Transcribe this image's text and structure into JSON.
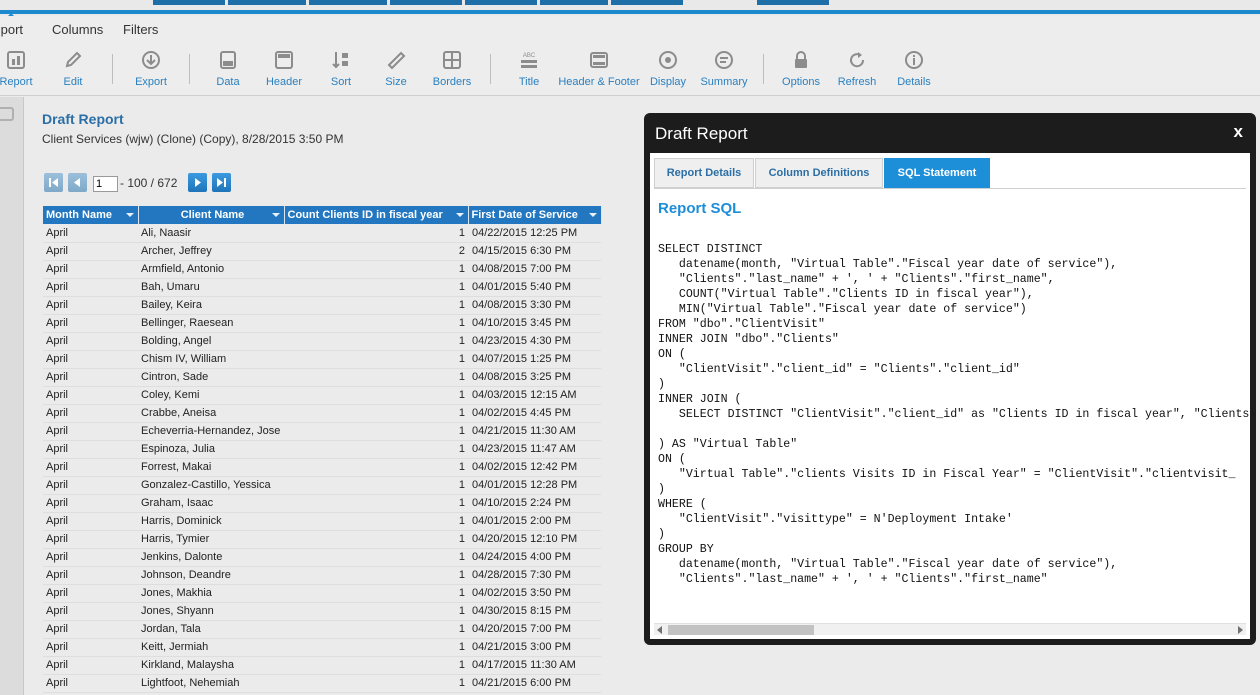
{
  "menu": {
    "items": [
      "Report",
      "Columns",
      "Filters"
    ]
  },
  "toolbar": {
    "items": [
      {
        "label": "Report",
        "icon": "report-icon"
      },
      {
        "label": "Edit",
        "icon": "pencil-icon"
      },
      {
        "label": "Export",
        "icon": "export-icon"
      },
      {
        "label": "Data",
        "icon": "data-icon"
      },
      {
        "label": "Header",
        "icon": "header-icon"
      },
      {
        "label": "Sort",
        "icon": "sort-icon"
      },
      {
        "label": "Size",
        "icon": "ruler-icon"
      },
      {
        "label": "Borders",
        "icon": "borders-icon"
      },
      {
        "label": "Title",
        "icon": "title-icon"
      },
      {
        "label": "Header & Footer",
        "icon": "header-footer-icon"
      },
      {
        "label": "Display",
        "icon": "display-icon"
      },
      {
        "label": "Summary",
        "icon": "summary-icon"
      },
      {
        "label": "Options",
        "icon": "lock-icon"
      },
      {
        "label": "Refresh",
        "icon": "refresh-icon"
      },
      {
        "label": "Details",
        "icon": "info-icon"
      }
    ]
  },
  "report": {
    "title": "Draft Report",
    "subtitle": "Client Services (wjw) (Clone) (Copy), 8/28/2015 3:50 PM"
  },
  "pager": {
    "page": "1",
    "range_text": "- 100 / 672"
  },
  "table": {
    "columns": [
      "Month Name",
      "Client Name",
      "Count Clients ID in fiscal year",
      "First Date of Service"
    ],
    "rows": [
      [
        "April",
        "Ali, Naasir",
        "1",
        "04/22/2015 12:25 PM"
      ],
      [
        "April",
        "Archer, Jeffrey",
        "2",
        "04/15/2015 6:30 PM"
      ],
      [
        "April",
        "Armfield, Antonio",
        "1",
        "04/08/2015 7:00 PM"
      ],
      [
        "April",
        "Bah, Umaru",
        "1",
        "04/01/2015 5:40 PM"
      ],
      [
        "April",
        "Bailey, Keira",
        "1",
        "04/08/2015 3:30 PM"
      ],
      [
        "April",
        "Bellinger, Raesean",
        "1",
        "04/10/2015 3:45 PM"
      ],
      [
        "April",
        "Bolding, Angel",
        "1",
        "04/23/2015 4:30 PM"
      ],
      [
        "April",
        "Chism IV, William",
        "1",
        "04/07/2015 1:25 PM"
      ],
      [
        "April",
        "Cintron, Sade",
        "1",
        "04/08/2015 3:25 PM"
      ],
      [
        "April",
        "Coley, Kemi",
        "1",
        "04/03/2015 12:15 AM"
      ],
      [
        "April",
        "Crabbe, Aneisa",
        "1",
        "04/02/2015 4:45 PM"
      ],
      [
        "April",
        "Echeverria-Hernandez, Jose",
        "1",
        "04/21/2015 11:30 AM"
      ],
      [
        "April",
        "Espinoza, Julia",
        "1",
        "04/23/2015 11:47 AM"
      ],
      [
        "April",
        "Forrest, Makai",
        "1",
        "04/02/2015 12:42 PM"
      ],
      [
        "April",
        "Gonzalez-Castillo, Yessica",
        "1",
        "04/01/2015 12:28 PM"
      ],
      [
        "April",
        "Graham, Isaac",
        "1",
        "04/10/2015 2:24 PM"
      ],
      [
        "April",
        "Harris, Dominick",
        "1",
        "04/01/2015 2:00 PM"
      ],
      [
        "April",
        "Harris, Tymier",
        "1",
        "04/20/2015 12:10 PM"
      ],
      [
        "April",
        "Jenkins, Dalonte",
        "1",
        "04/24/2015 4:00 PM"
      ],
      [
        "April",
        "Johnson, Deandre",
        "1",
        "04/28/2015 7:30 PM"
      ],
      [
        "April",
        "Jones, Makhia",
        "1",
        "04/02/2015 3:50 PM"
      ],
      [
        "April",
        "Jones, Shyann",
        "1",
        "04/30/2015 8:15 PM"
      ],
      [
        "April",
        "Jordan, Tala",
        "1",
        "04/20/2015 7:00 PM"
      ],
      [
        "April",
        "Keitt, Jermiah",
        "1",
        "04/21/2015 3:00 PM"
      ],
      [
        "April",
        "Kirkland, Malaysha",
        "1",
        "04/17/2015 11:30 AM"
      ],
      [
        "April",
        "Lightfoot, Nehemiah",
        "1",
        "04/21/2015 6:00 PM"
      ]
    ]
  },
  "dialog": {
    "title": "Draft Report",
    "close": "x",
    "tabs": [
      "Report Details",
      "Column Definitions",
      "SQL Statement"
    ],
    "active_tab": "SQL Statement",
    "sql_heading": "Report SQL",
    "sql": "SELECT DISTINCT\n   datename(month, \"Virtual Table\".\"Fiscal year date of service\"),\n   \"Clients\".\"last_name\" + ', ' + \"Clients\".\"first_name\",\n   COUNT(\"Virtual Table\".\"Clients ID in fiscal year\"),\n   MIN(\"Virtual Table\".\"Fiscal year date of service\")\nFROM \"dbo\".\"ClientVisit\"\nINNER JOIN \"dbo\".\"Clients\"\nON (\n   \"ClientVisit\".\"client_id\" = \"Clients\".\"client_id\"\n)\nINNER JOIN (\n   SELECT DISTINCT \"ClientVisit\".\"client_id\" as \"Clients ID in fiscal year\", \"Clients\n\n) AS \"Virtual Table\"\nON (\n   \"Virtual Table\".\"clients Visits ID in Fiscal Year\" = \"ClientVisit\".\"clientvisit_\n)\nWHERE (\n   \"ClientVisit\".\"visittype\" = N'Deployment Intake'\n)\nGROUP BY\n   datename(month, \"Virtual Table\".\"Fiscal year date of service\"),\n   \"Clients\".\"last_name\" + ', ' + \"Clients\".\"first_name\""
  },
  "colors": {
    "accent": "#1d8ad0",
    "header_bg": "#2277c0",
    "dialog_bg": "#1c1c1c"
  }
}
